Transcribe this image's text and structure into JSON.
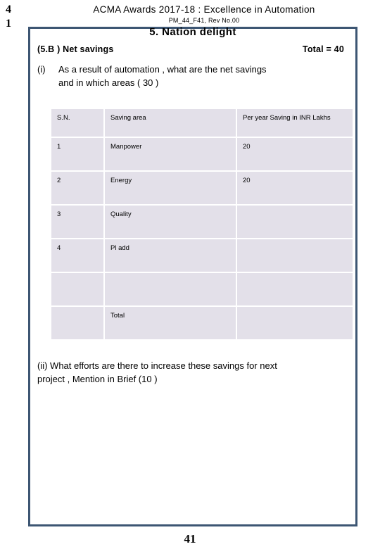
{
  "margin_markers": [
    "4",
    "1"
  ],
  "header": {
    "title": "ACMA  Awards  2017-18 : Excellence in Automation",
    "subtitle": "PM_44_F41, Rev No.00"
  },
  "content": {
    "section_title": "5.  Nation  delight",
    "question_label": "(5.B )   Net savings",
    "total_label": "Total  = 40",
    "sub_question_i": {
      "marker": "(i)",
      "line1": "As  a result  of  automation , what are  the  net  savings",
      "line2": "and  in which  areas  ( 30 )"
    },
    "sub_question_ii": {
      "line1": "(ii)  What  efforts  are there  to increase  these  savings  for  next",
      "line2": "project , Mention in Brief (10 )"
    }
  },
  "table": {
    "columns": [
      "S.N.",
      "Saving  area",
      "Per  year Saving in INR Lakhs"
    ],
    "rows": [
      {
        "sn": "1",
        "area": "Manpower",
        "value": "20"
      },
      {
        "sn": "2",
        "area": "Energy",
        "value": "20"
      },
      {
        "sn": "3",
        "area": "Quality",
        "value": ""
      },
      {
        "sn": "4",
        "area": "Pl add",
        "value": ""
      },
      {
        "sn": "",
        "area": "",
        "value": ""
      },
      {
        "sn": "",
        "area": "Total",
        "value": ""
      }
    ]
  },
  "footer": {
    "page_number": "41"
  },
  "colors": {
    "frame_border": "#3d5673",
    "table_cell_fill": "#e3e0e9",
    "text": "#000000",
    "page_background": "#ffffff"
  }
}
